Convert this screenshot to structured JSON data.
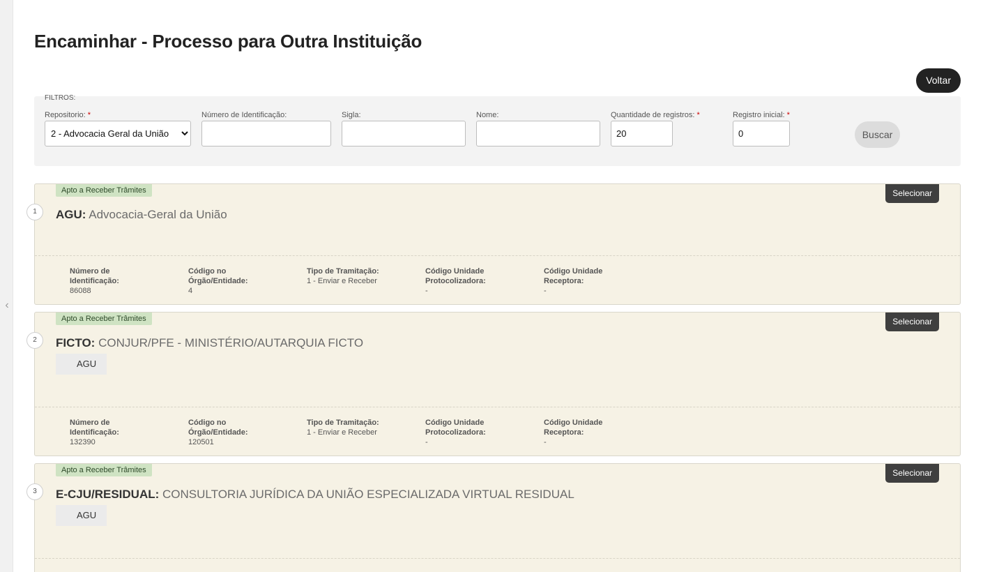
{
  "nav": {
    "collapse_glyph": "‹"
  },
  "page": {
    "title": "Encaminhar - Processo para Outra Instituição",
    "back_label": "Voltar"
  },
  "filters": {
    "section_label": "FILTROS:",
    "repositorio": {
      "label": "Repositorio:",
      "required_mark": "*",
      "value": "2 - Advocacia Geral da União"
    },
    "numero": {
      "label": "Número de Identificação:",
      "value": ""
    },
    "sigla": {
      "label": "Sigla:",
      "value": ""
    },
    "nome": {
      "label": "Nome:",
      "value": ""
    },
    "quantidade": {
      "label": "Quantidade de registros:",
      "required_mark": "*",
      "value": "20"
    },
    "inicial": {
      "label": "Registro inicial:",
      "required_mark": "*",
      "value": "0"
    },
    "search_label": "Buscar"
  },
  "results": [
    {
      "index": "1",
      "badge": "Apto a Receber Trâmites",
      "select_label": "Selecionar",
      "sigla": "AGU:",
      "nome": "Advocacia-Geral da União",
      "parent": "",
      "details": {
        "numero_label": "Número de Identificação:",
        "numero_value": "86088",
        "codigo_label": "Código no Órgão/Entidade:",
        "codigo_value": "4",
        "tipo_label": "Tipo de Tramitação:",
        "tipo_value": "1 - Enviar e Receber",
        "protocolizadora_label": "Código Unidade Protocolizadora:",
        "protocolizadora_value": "-",
        "receptora_label": "Código Unidade Receptora:",
        "receptora_value": "-"
      }
    },
    {
      "index": "2",
      "badge": "Apto a Receber Trâmites",
      "select_label": "Selecionar",
      "sigla": "FICTO:",
      "nome": "CONJUR/PFE - MINISTÉRIO/AUTARQUIA FICTO",
      "parent": "AGU",
      "details": {
        "numero_label": "Número de Identificação:",
        "numero_value": "132390",
        "codigo_label": "Código no Órgão/Entidade:",
        "codigo_value": "120501",
        "tipo_label": "Tipo de Tramitação:",
        "tipo_value": "1 - Enviar e Receber",
        "protocolizadora_label": "Código Unidade Protocolizadora:",
        "protocolizadora_value": "-",
        "receptora_label": "Código Unidade Receptora:",
        "receptora_value": "-"
      }
    },
    {
      "index": "3",
      "badge": "Apto a Receber Trâmites",
      "select_label": "Selecionar",
      "sigla": "E-CJU/RESIDUAL:",
      "nome": "CONSULTORIA JURÍDICA DA UNIÃO ESPECIALIZADA VIRTUAL RESIDUAL",
      "parent": "AGU"
    }
  ]
}
